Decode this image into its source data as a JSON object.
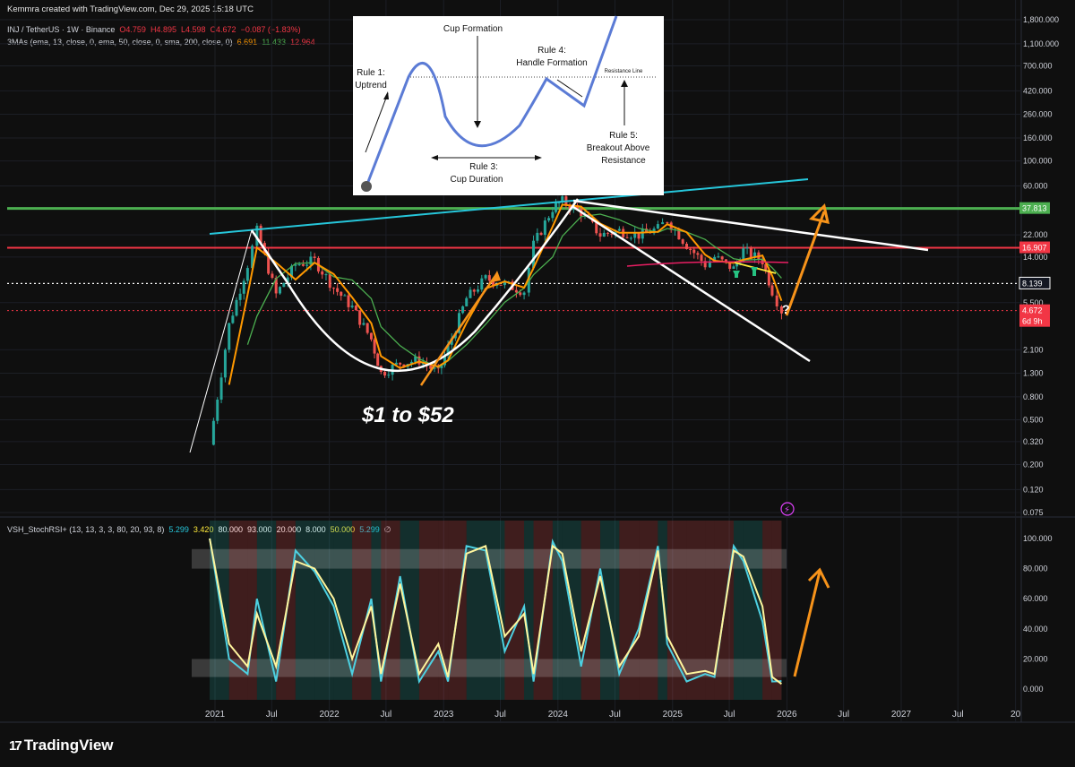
{
  "header": {
    "created": "Kemmra created with TradingView.com, Dec 29, 2025 15:18 UTC",
    "symbol": "INJ / TetherUS · 1W · Binance",
    "ohlc": {
      "o": "O4.759",
      "h": "H4.895",
      "l": "L4.598",
      "c": "C4.672",
      "chg": "−0.087 (−1.83%)"
    },
    "ma_label": "3MAs (ema, 13, close, 0, ema, 50, close, 0, sma, 200, close, 0)",
    "ma_values": [
      "6.691",
      "11.433",
      "12.964"
    ]
  },
  "oscillator": {
    "label": "VSH_StochRSI+ (13, 13, 3, 3, 80, 20, 93, 8)",
    "values": [
      "5.299",
      "3.420",
      "80.000",
      "93.000",
      "20.000",
      "8.000",
      "50.000",
      "5.299"
    ],
    "symbol": "∅",
    "axis_ticks": [
      "100.000",
      "80.000",
      "60.000",
      "40.000",
      "20.000",
      "0.000"
    ]
  },
  "price_axis_ticks": [
    "1,800.000",
    "1,100.000",
    "700.000",
    "420.000",
    "260.000",
    "160.000",
    "100.000",
    "60.000",
    "22.000",
    "14.000",
    "5.500",
    "2.100",
    "1.300",
    "0.800",
    "0.500",
    "0.320",
    "0.200",
    "0.120",
    "0.075"
  ],
  "price_labels": [
    {
      "value": "37.813",
      "color": "#4caf50"
    },
    {
      "value": "16.907",
      "color": "#f23645"
    },
    {
      "value": "8.139",
      "color": "#131722"
    },
    {
      "value": "4.672",
      "color": "#f23645"
    },
    {
      "value": "6d 9h",
      "color": "#f23645"
    }
  ],
  "time_axis": [
    "2021",
    "Jul",
    "2022",
    "Jul",
    "2023",
    "Jul",
    "2024",
    "Jul",
    "2025",
    "Jul",
    "2026",
    "Jul",
    "2027",
    "Jul",
    "20"
  ],
  "annotation_main": "$1 to $52",
  "annotation_question": "?",
  "inset": {
    "rule1": "Rule 1:",
    "rule1b": "Uptrend",
    "cup": "Cup Formation",
    "rule4": "Rule 4:",
    "rule4b": "Handle Formation",
    "resistance": "Resistance Line",
    "rule3": "Rule 3:",
    "rule3b": "Cup Duration",
    "rule5": "Rule 5:",
    "rule5b": "Breakout Above",
    "rule5c": "Resistance"
  },
  "logo": "TradingView",
  "colors": {
    "background": "#0f0f0f",
    "up": "#26a69a",
    "down": "#ef5350",
    "ema13": "#ff9800",
    "ema50": "#4caf50",
    "sma200": "#f23645",
    "resistance_green": "#4caf50",
    "resistance_red": "#f23645",
    "trend_blue": "#26c6da",
    "arrow": "#f7931a"
  },
  "chart_data": [
    {
      "type": "candlestick",
      "title": "INJ / TetherUS · 1W · Binance",
      "scale": "log",
      "ylim": [
        0.075,
        1800
      ],
      "x": [
        "2020-12",
        "2021-02",
        "2021-04",
        "2021-05",
        "2021-07",
        "2021-09",
        "2021-11",
        "2022-01",
        "2022-03",
        "2022-05",
        "2022-06",
        "2022-08",
        "2022-10",
        "2022-12",
        "2023-01",
        "2023-03",
        "2023-05",
        "2023-07",
        "2023-09",
        "2023-10",
        "2023-12",
        "2024-01",
        "2024-03",
        "2024-05",
        "2024-07",
        "2024-09",
        "2024-11",
        "2024-12",
        "2025-02",
        "2025-04",
        "2025-05",
        "2025-07",
        "2025-08",
        "2025-10",
        "2025-11",
        "2025-12"
      ],
      "close": [
        0.3,
        3.5,
        12,
        24,
        6.5,
        12,
        13,
        7.5,
        5,
        2.6,
        1.3,
        1.6,
        1.7,
        1.3,
        2.2,
        6,
        9,
        8,
        7,
        18,
        38,
        44,
        35,
        22,
        24,
        22,
        25,
        30,
        18,
        12,
        14,
        11,
        16,
        13,
        7,
        4.672
      ],
      "series_ma": [
        {
          "name": "ema 13",
          "value_last": 6.691
        },
        {
          "name": "ema 50",
          "value_last": 11.433
        },
        {
          "name": "sma 200",
          "value_last": 12.964
        }
      ],
      "horizontal_levels": [
        37.813,
        16.907,
        8.139,
        4.672
      ],
      "grid": true
    },
    {
      "type": "line",
      "title": "VSH_StochRSI+ (13, 13, 3, 3, 80, 20, 93, 8)",
      "ylim": [
        0,
        100
      ],
      "bands": [
        [
          80,
          93
        ],
        [
          8,
          20
        ]
      ],
      "x": [
        "2020-12",
        "2021-02",
        "2021-04",
        "2021-05",
        "2021-07",
        "2021-09",
        "2021-11",
        "2022-01",
        "2022-03",
        "2022-05",
        "2022-06",
        "2022-08",
        "2022-10",
        "2022-12",
        "2023-01",
        "2023-03",
        "2023-05",
        "2023-07",
        "2023-09",
        "2023-10",
        "2023-12",
        "2024-01",
        "2024-03",
        "2024-05",
        "2024-07",
        "2024-09",
        "2024-11",
        "2024-12",
        "2025-02",
        "2025-04",
        "2025-05",
        "2025-07",
        "2025-08",
        "2025-10",
        "2025-11",
        "2025-12"
      ],
      "series": [
        {
          "name": "K",
          "values": [
            100,
            20,
            10,
            60,
            5,
            92,
            78,
            55,
            10,
            60,
            5,
            75,
            5,
            25,
            5,
            95,
            92,
            25,
            55,
            5,
            98,
            85,
            15,
            80,
            10,
            40,
            95,
            30,
            5,
            10,
            8,
            95,
            85,
            45,
            5,
            5.299
          ]
        },
        {
          "name": "D",
          "values": [
            100,
            30,
            15,
            50,
            15,
            85,
            80,
            60,
            20,
            55,
            10,
            70,
            10,
            30,
            8,
            90,
            95,
            35,
            50,
            10,
            95,
            90,
            25,
            75,
            15,
            35,
            92,
            35,
            10,
            12,
            10,
            92,
            88,
            55,
            8,
            3.42
          ]
        }
      ]
    }
  ]
}
